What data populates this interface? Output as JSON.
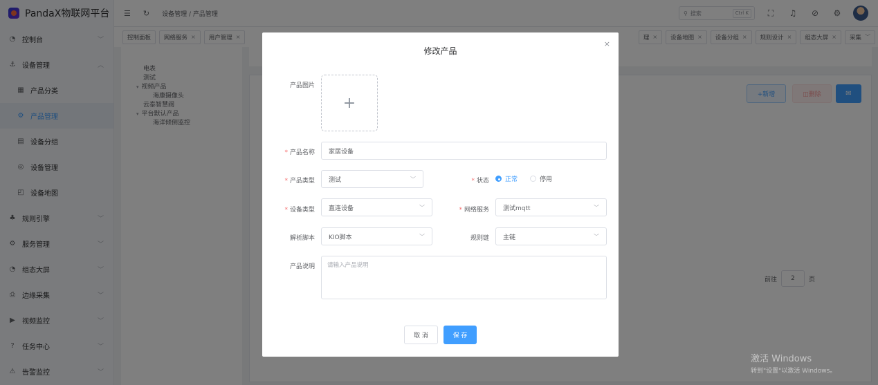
{
  "app": {
    "title": "PandaX物联网平台"
  },
  "sidebar": {
    "items": [
      {
        "icon": "◔",
        "label": "控制台",
        "expandable": true
      },
      {
        "icon": "⚓",
        "label": "设备管理",
        "expandable": true,
        "expanded": true
      },
      {
        "icon": "▦",
        "label": "产品分类",
        "sub": true
      },
      {
        "icon": "⚙",
        "label": "产品管理",
        "sub": true,
        "active": true
      },
      {
        "icon": "▤",
        "label": "设备分组",
        "sub": true
      },
      {
        "icon": "◎",
        "label": "设备管理",
        "sub": true
      },
      {
        "icon": "◰",
        "label": "设备地图",
        "sub": true
      },
      {
        "icon": "♣",
        "label": "规则引擎",
        "expandable": true
      },
      {
        "icon": "⚙",
        "label": "服务管理",
        "expandable": true
      },
      {
        "icon": "◔",
        "label": "组态大屏",
        "expandable": true
      },
      {
        "icon": "⎙",
        "label": "边缘采集",
        "expandable": true
      },
      {
        "icon": "▶",
        "label": "视频监控",
        "expandable": true
      },
      {
        "icon": "?",
        "label": "任务中心",
        "expandable": true
      },
      {
        "icon": "⚠",
        "label": "告警监控",
        "expandable": true
      }
    ]
  },
  "header": {
    "breadcrumb": "设备管理 / 产品管理",
    "search_placeholder": "搜索",
    "search_shortcut": "Ctrl K"
  },
  "tags": {
    "left": [
      {
        "label": "控制面板",
        "closable": false
      },
      {
        "label": "网络服务",
        "closable": true
      },
      {
        "label": "用户管理",
        "closable": true
      }
    ],
    "right": [
      {
        "label": "理",
        "closable": true
      },
      {
        "label": "设备地图",
        "closable": true
      },
      {
        "label": "设备分组",
        "closable": true
      },
      {
        "label": "规则设计",
        "closable": true
      },
      {
        "label": "组态大屏",
        "closable": true
      },
      {
        "label": "采集",
        "closable": false,
        "dropdown": true
      }
    ]
  },
  "tree": {
    "nodes": [
      {
        "label": "电表",
        "level": 1
      },
      {
        "label": "测试",
        "level": 1
      },
      {
        "label": "视频产品",
        "level": 1,
        "expanded": true
      },
      {
        "label": "海康摄像头",
        "level": 2
      },
      {
        "label": "云泰智慧阀",
        "level": 1
      },
      {
        "label": "平台默认产品",
        "level": 1,
        "expanded": true
      },
      {
        "label": "海洋倾倒监控",
        "level": 2
      }
    ]
  },
  "toolbar": {
    "add_label": "+新增",
    "delete_label": "◫删除",
    "misc_icon": "✉"
  },
  "pagination": {
    "goto_label": "前往",
    "page": "2",
    "page_suffix": "页"
  },
  "dialog": {
    "title": "修改产品",
    "close_icon": "×",
    "fields": {
      "image": {
        "label": "产品图片",
        "icon": "+"
      },
      "name": {
        "label": "产品名称",
        "value": "家居设备",
        "required": true
      },
      "type": {
        "label": "产品类型",
        "value": "测试",
        "required": true
      },
      "status": {
        "label": "状态",
        "required": true,
        "options": [
          "正常",
          "停用"
        ],
        "selected": "正常"
      },
      "device_type": {
        "label": "设备类型",
        "value": "直连设备",
        "required": true
      },
      "network": {
        "label": "网络服务",
        "value": "测试mqtt",
        "required": true
      },
      "script": {
        "label": "解析脚本",
        "value": "KIO脚本"
      },
      "rule_chain": {
        "label": "规则链",
        "value": "主链"
      },
      "description": {
        "label": "产品说明",
        "placeholder": "请输入产品说明"
      }
    },
    "cancel_label": "取 消",
    "save_label": "保 存"
  },
  "watermark": {
    "line1": "激活 Windows",
    "line2": "转到\"设置\"以激活 Windows。"
  },
  "colors": {
    "primary": "#409eff",
    "danger": "#f56c6c"
  }
}
